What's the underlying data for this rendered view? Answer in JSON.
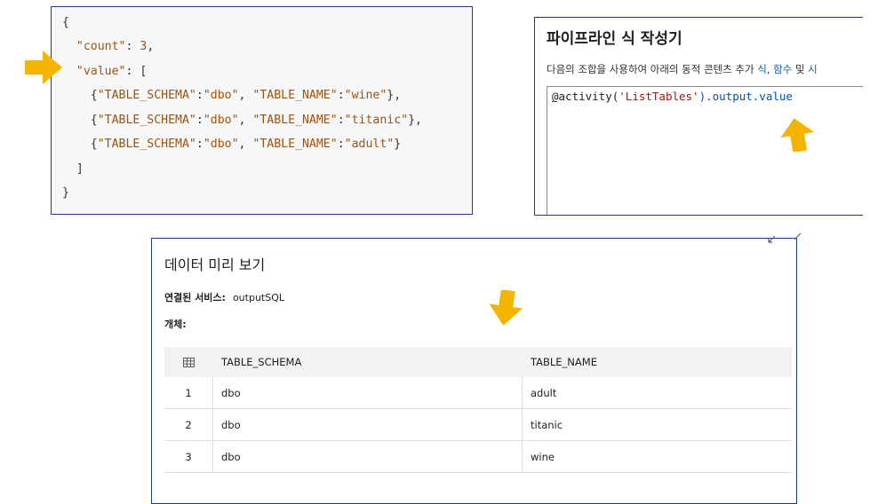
{
  "code_panel": {
    "lines": [
      "{",
      "  \"count\": 3,",
      "  \"value\": [",
      "    {\"TABLE_SCHEMA\":\"dbo\", \"TABLE_NAME\":\"wine\"},",
      "    {\"TABLE_SCHEMA\":\"dbo\", \"TABLE_NAME\":\"titanic\"},",
      "    {\"TABLE_SCHEMA\":\"dbo\", \"TABLE_NAME\":\"adult\"}",
      "  ]",
      "}"
    ]
  },
  "builder": {
    "title": "파이프라인 식 작성기",
    "desc_prefix": "다음의 조합을 사용하여 아래의 동적 콘텐츠 추가 ",
    "desc_link_1": "식",
    "desc_sep_1": ", ",
    "desc_link_2": "함수",
    "desc_sep_2": " 및 ",
    "desc_link_3": "시",
    "expression": {
      "at": "@",
      "fn": "activity(",
      "arg": "'ListTables'",
      "rest": ").output.value"
    }
  },
  "preview": {
    "title": "데이터 미리 보기",
    "linked_service_label": "연결된 서비스:",
    "linked_service_value": "outputSQL",
    "object_label": "개체:",
    "columns": [
      "TABLE_SCHEMA",
      "TABLE_NAME"
    ],
    "rows": [
      {
        "index": "1",
        "schema": "dbo",
        "name": "adult"
      },
      {
        "index": "2",
        "schema": "dbo",
        "name": "titanic"
      },
      {
        "index": "3",
        "schema": "dbo",
        "name": "wine"
      }
    ]
  },
  "icons": {
    "grid": "table-grid-icon",
    "arrow": "callout-arrow-icon",
    "expand": "expand-icon"
  },
  "colors": {
    "arrow": "#f5b301",
    "panel_border": "#1e3a8a",
    "json_value": "#a0520b",
    "link": "#0b5cad"
  }
}
